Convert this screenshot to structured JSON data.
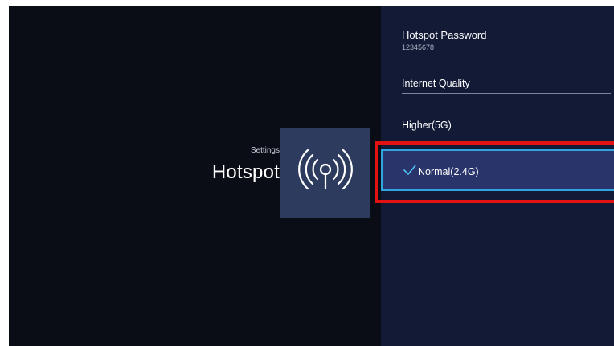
{
  "header": {
    "breadcrumb": "Settings",
    "title": "Hotspot",
    "icon": "wifi-hotspot-icon"
  },
  "panel": {
    "password_label": "Hotspot Password",
    "password_value": "12345678",
    "quality_label": "Internet Quality",
    "options": [
      {
        "label": "Higher(5G)",
        "selected": false
      },
      {
        "label": "Normal(2.4G)",
        "selected": true
      }
    ]
  },
  "colors": {
    "background": "#0a0c16",
    "panel": "#121a36",
    "icon_tile": "#2d3b5f",
    "selected_row": "#29346a",
    "focus_border": "#2fa6e0",
    "highlight": "#e31212"
  }
}
